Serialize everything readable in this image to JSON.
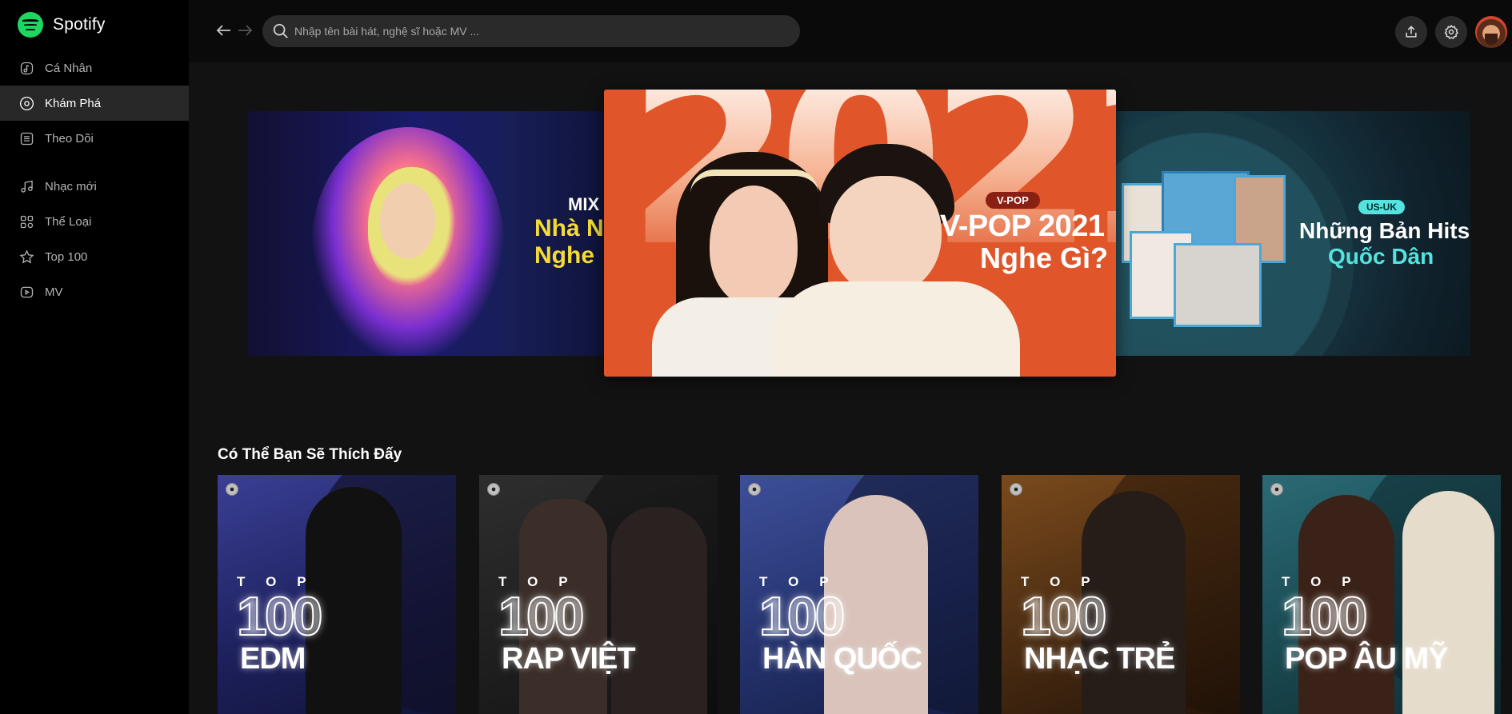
{
  "app": {
    "name": "Spotify",
    "brand_color": "#1ed760"
  },
  "sidebar": {
    "items": [
      {
        "label": "Cá Nhân",
        "icon": "music-note-square-icon",
        "active": false
      },
      {
        "label": "Khám Phá",
        "icon": "disc-icon",
        "active": true
      },
      {
        "label": "Theo Dõi",
        "icon": "list-icon",
        "active": false
      },
      {
        "label": "Nhạc mới",
        "icon": "music-notes-icon",
        "active": false
      },
      {
        "label": "Thể Loại",
        "icon": "grid-icon",
        "active": false
      },
      {
        "label": "Top 100",
        "icon": "star-icon",
        "active": false
      },
      {
        "label": "MV",
        "icon": "video-icon",
        "active": false
      }
    ]
  },
  "header": {
    "search_placeholder": "Nhập tên bài hát, nghệ sĩ hoặc MV ...",
    "back_icon": "arrow-left-icon",
    "forward_icon": "arrow-right-icon",
    "upload_icon": "upload-icon",
    "settings_icon": "gear-icon"
  },
  "banners": {
    "left": {
      "line1": "MIX",
      "line2": "Nhà N",
      "line3": "Nghe"
    },
    "center": {
      "tag": "V-POP",
      "year": "2021",
      "title1": "V-POP 2021",
      "title2": "Nghe Gì?"
    },
    "right": {
      "tag": "US-UK",
      "title1": "Những Bản Hits",
      "title2": "Quốc Dân"
    }
  },
  "section": {
    "title": "Có Thể Bạn Sẽ Thích Đấy",
    "cards": [
      {
        "top": "TOP",
        "num": "100",
        "genre": "EDM",
        "color": "#2a2f7a"
      },
      {
        "top": "TOP",
        "num": "100",
        "genre": "RAP VIỆT",
        "color": "#262626"
      },
      {
        "top": "TOP",
        "num": "100",
        "genre": "HÀN QUỐC",
        "color": "#2c3b78"
      },
      {
        "top": "TOP",
        "num": "100",
        "genre": "NHẠC TRẺ",
        "color": "#5a3514"
      },
      {
        "top": "TOP",
        "num": "100",
        "genre": "POP ÂU MỸ",
        "color": "#1d4952"
      }
    ]
  }
}
